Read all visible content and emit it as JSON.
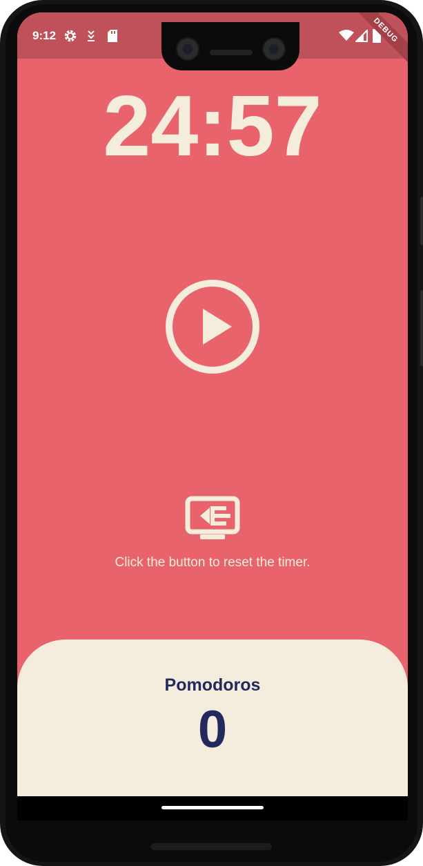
{
  "status_bar": {
    "time": "9:12",
    "left_icons": [
      "settings-icon",
      "download-icon",
      "sd-card-icon"
    ],
    "right_icons": [
      "wifi-icon",
      "cellular-signal-icon",
      "battery-icon"
    ]
  },
  "debug_banner": "DEBUG",
  "timer": {
    "display": "24:57"
  },
  "controls": {
    "play_icon": "play-circle-icon",
    "reset_icon": "reset-timer-icon",
    "reset_hint": "Click the button to reset the timer."
  },
  "pomodoros": {
    "label": "Pomodoros",
    "count": "0"
  },
  "colors": {
    "background": "#e8636c",
    "status_bar": "#bf515a",
    "foreground_light": "#f5eddc",
    "panel": "#f4ecdc",
    "panel_text": "#23295c"
  }
}
